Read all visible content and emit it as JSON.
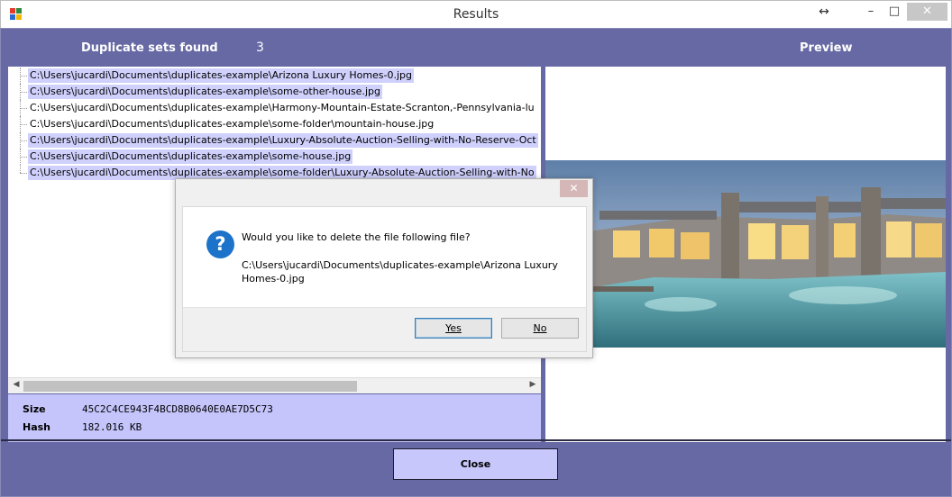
{
  "window": {
    "title": "Results",
    "resize_glyph": "↔",
    "minimize_glyph": "–",
    "maximize_glyph": "□",
    "close_glyph": "✕"
  },
  "header": {
    "duplicates_label": "Duplicate sets found",
    "duplicates_count": "3",
    "preview_label": "Preview"
  },
  "tree": {
    "items": [
      {
        "path": "C:\\Users\\jucardi\\Documents\\duplicates-example\\Arizona Luxury Homes-0.jpg",
        "highlighted": true
      },
      {
        "path": "C:\\Users\\jucardi\\Documents\\duplicates-example\\some-other-house.jpg",
        "highlighted": true
      },
      {
        "path": "C:\\Users\\jucardi\\Documents\\duplicates-example\\Harmony-Mountain-Estate-Scranton,-Pennsylvania-lu",
        "highlighted": false
      },
      {
        "path": "C:\\Users\\jucardi\\Documents\\duplicates-example\\some-folder\\mountain-house.jpg",
        "highlighted": false
      },
      {
        "path": "C:\\Users\\jucardi\\Documents\\duplicates-example\\Luxury-Absolute-Auction-Selling-with-No-Reserve-Oct",
        "highlighted": true
      },
      {
        "path": "C:\\Users\\jucardi\\Documents\\duplicates-example\\some-house.jpg",
        "highlighted": true
      },
      {
        "path": "C:\\Users\\jucardi\\Documents\\duplicates-example\\some-folder\\Luxury-Absolute-Auction-Selling-with-No",
        "highlighted": true
      }
    ],
    "scroll_left_glyph": "◀",
    "scroll_right_glyph": "▶"
  },
  "info": {
    "size_label": "Size",
    "size_value": "45C2C4CE943F4BCD8B0640E0AE7D5C73",
    "hash_label": "Hash",
    "hash_value": "182.016 KB"
  },
  "footer": {
    "close_label": "Close"
  },
  "dialog": {
    "close_glyph": "✕",
    "icon": "question-icon",
    "question": "Would you like to delete the file following file?",
    "path_line1": "C:\\Users\\jucardi\\Documents\\duplicates-example\\Arizona Luxury",
    "path_line2": "Homes-0.jpg",
    "yes_label": "Yes",
    "no_label": "No"
  },
  "colors": {
    "frame": "#6669a4",
    "highlight": "#cfd0fc",
    "info_panel": "#c5c5fc",
    "close_button": "#c7c7fb",
    "question_icon": "#1d72c9"
  }
}
